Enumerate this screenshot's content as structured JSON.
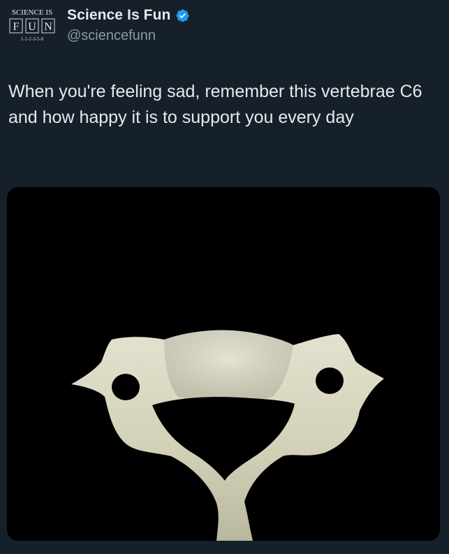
{
  "account": {
    "display_name": "Science Is Fun",
    "handle": "@sciencefunn",
    "verified": true,
    "verified_icon": "verified-badge-icon",
    "avatar": {
      "line1": "SCIENCE IS",
      "letters": [
        "F",
        "U",
        "N"
      ],
      "sequence": "1-1-2-3-5-8"
    }
  },
  "tweet": {
    "text": "When you're feeling sad, remember this vertebrae C6 and how happy it is to support you every day"
  },
  "colors": {
    "background": "#15202b",
    "text": "#e7e9ea",
    "secondary_text": "#8b98a5",
    "verified_blue": "#1d9bf0",
    "media_background": "#000000",
    "bone": "#d8d6c2"
  }
}
